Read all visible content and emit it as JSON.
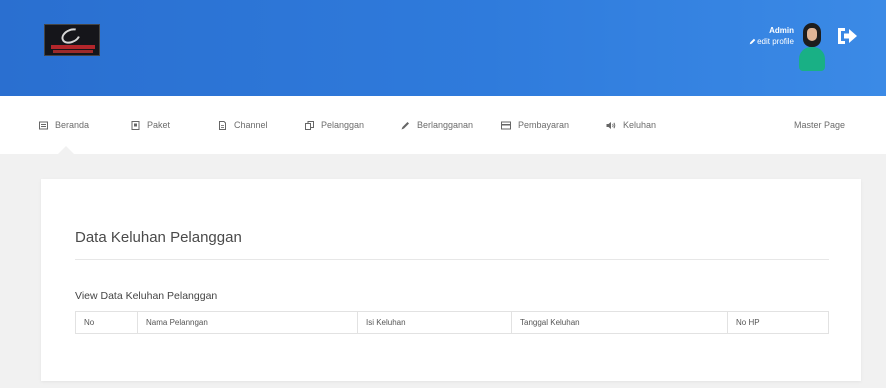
{
  "header": {
    "logo_name": "brand-logo",
    "user": {
      "name": "Admin",
      "edit_label": "edit profile"
    }
  },
  "nav": {
    "items": [
      {
        "label": "Beranda",
        "icon": "list-icon"
      },
      {
        "label": "Paket",
        "icon": "package-icon"
      },
      {
        "label": "Channel",
        "icon": "document-icon"
      },
      {
        "label": "Pelanggan",
        "icon": "copy-icon"
      },
      {
        "label": "Berlangganan",
        "icon": "pencil-icon"
      },
      {
        "label": "Pembayaran",
        "icon": "credit-card-icon"
      },
      {
        "label": "Keluhan",
        "icon": "volume-icon"
      }
    ],
    "right_label": "Master Page"
  },
  "main": {
    "title": "Data Keluhan Pelanggan",
    "subtitle": "View Data Keluhan Pelanggan",
    "table": {
      "columns": [
        "No",
        "Nama Pelanngan",
        "Isi Keluhan",
        "Tanggal Keluhan",
        "No HP"
      ],
      "rows": []
    }
  },
  "colors": {
    "header_bg": "#2f7bdc",
    "accent": "#19b085",
    "page_bg": "#f1f1f1"
  }
}
